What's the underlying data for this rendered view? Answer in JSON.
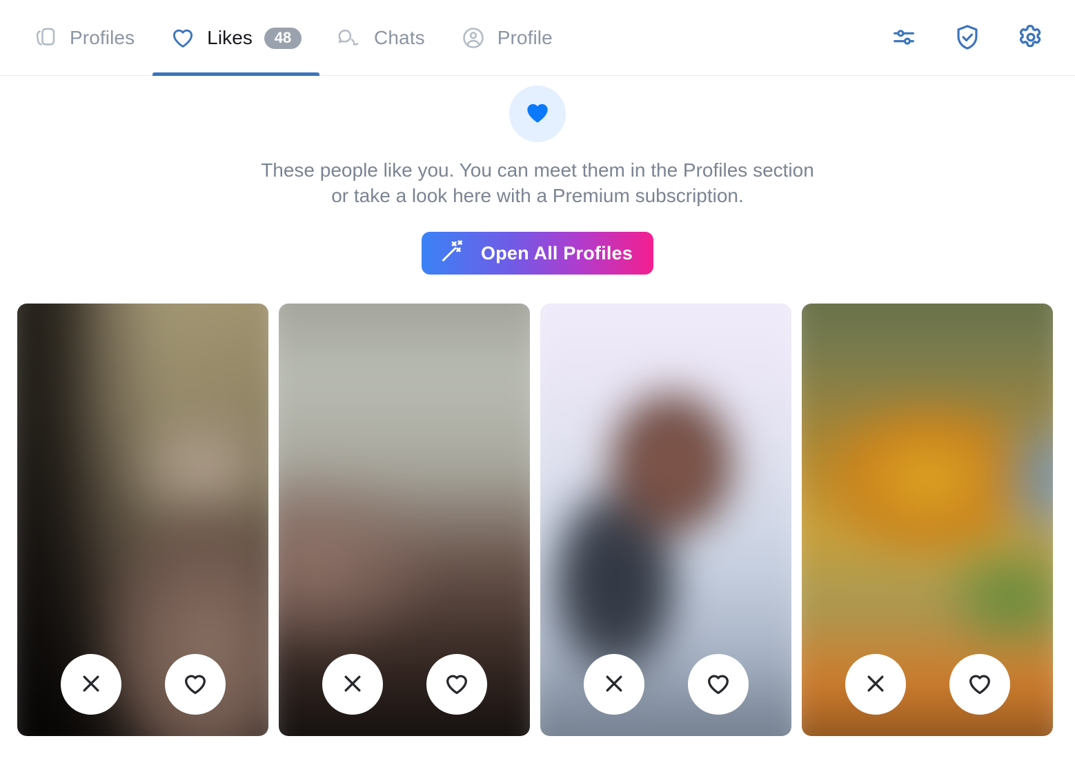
{
  "header": {
    "tabs": [
      {
        "label": "Profiles",
        "icon": "cards-stack-icon",
        "active": false,
        "badge": null
      },
      {
        "label": "Likes",
        "icon": "heart-outline-icon",
        "active": true,
        "badge": "48"
      },
      {
        "label": "Chats",
        "icon": "chat-bubbles-icon",
        "active": false,
        "badge": null
      },
      {
        "label": "Profile",
        "icon": "user-circle-icon",
        "active": false,
        "badge": null
      }
    ],
    "actions": [
      {
        "name": "filters-sliders-icon",
        "title": "Filters"
      },
      {
        "name": "shield-check-icon",
        "title": "Safety"
      },
      {
        "name": "gear-settings-icon",
        "title": "Settings"
      }
    ],
    "colors": {
      "accent": "#3a74bd",
      "inactive_text": "#8c95a3",
      "active_text": "#16181d",
      "badge_bg": "#9aa2ad"
    }
  },
  "promo": {
    "icon": "heart-filled-icon",
    "icon_color": "#0a79fb",
    "icon_bg": "#e4efff",
    "line1": "These people like you. You can meet them in the Profiles section",
    "line2": "or take a look here with a Premium subscription.",
    "cta_label": "Open All Profiles",
    "cta_icon": "magic-wand-icon",
    "cta_gradient_from": "#3b82f6",
    "cta_gradient_to": "#f41f8f"
  },
  "cards": [
    {
      "name": "liked-profile-card-1",
      "photo": "photo-1",
      "blurred": true,
      "dismiss_label": "Dismiss",
      "like_label": "Like"
    },
    {
      "name": "liked-profile-card-2",
      "photo": "photo-2",
      "blurred": true,
      "dismiss_label": "Dismiss",
      "like_label": "Like"
    },
    {
      "name": "liked-profile-card-3",
      "photo": "photo-3",
      "blurred": true,
      "dismiss_label": "Dismiss",
      "like_label": "Like"
    },
    {
      "name": "liked-profile-card-4",
      "photo": "photo-4",
      "blurred": true,
      "dismiss_label": "Dismiss",
      "like_label": "Like"
    }
  ]
}
